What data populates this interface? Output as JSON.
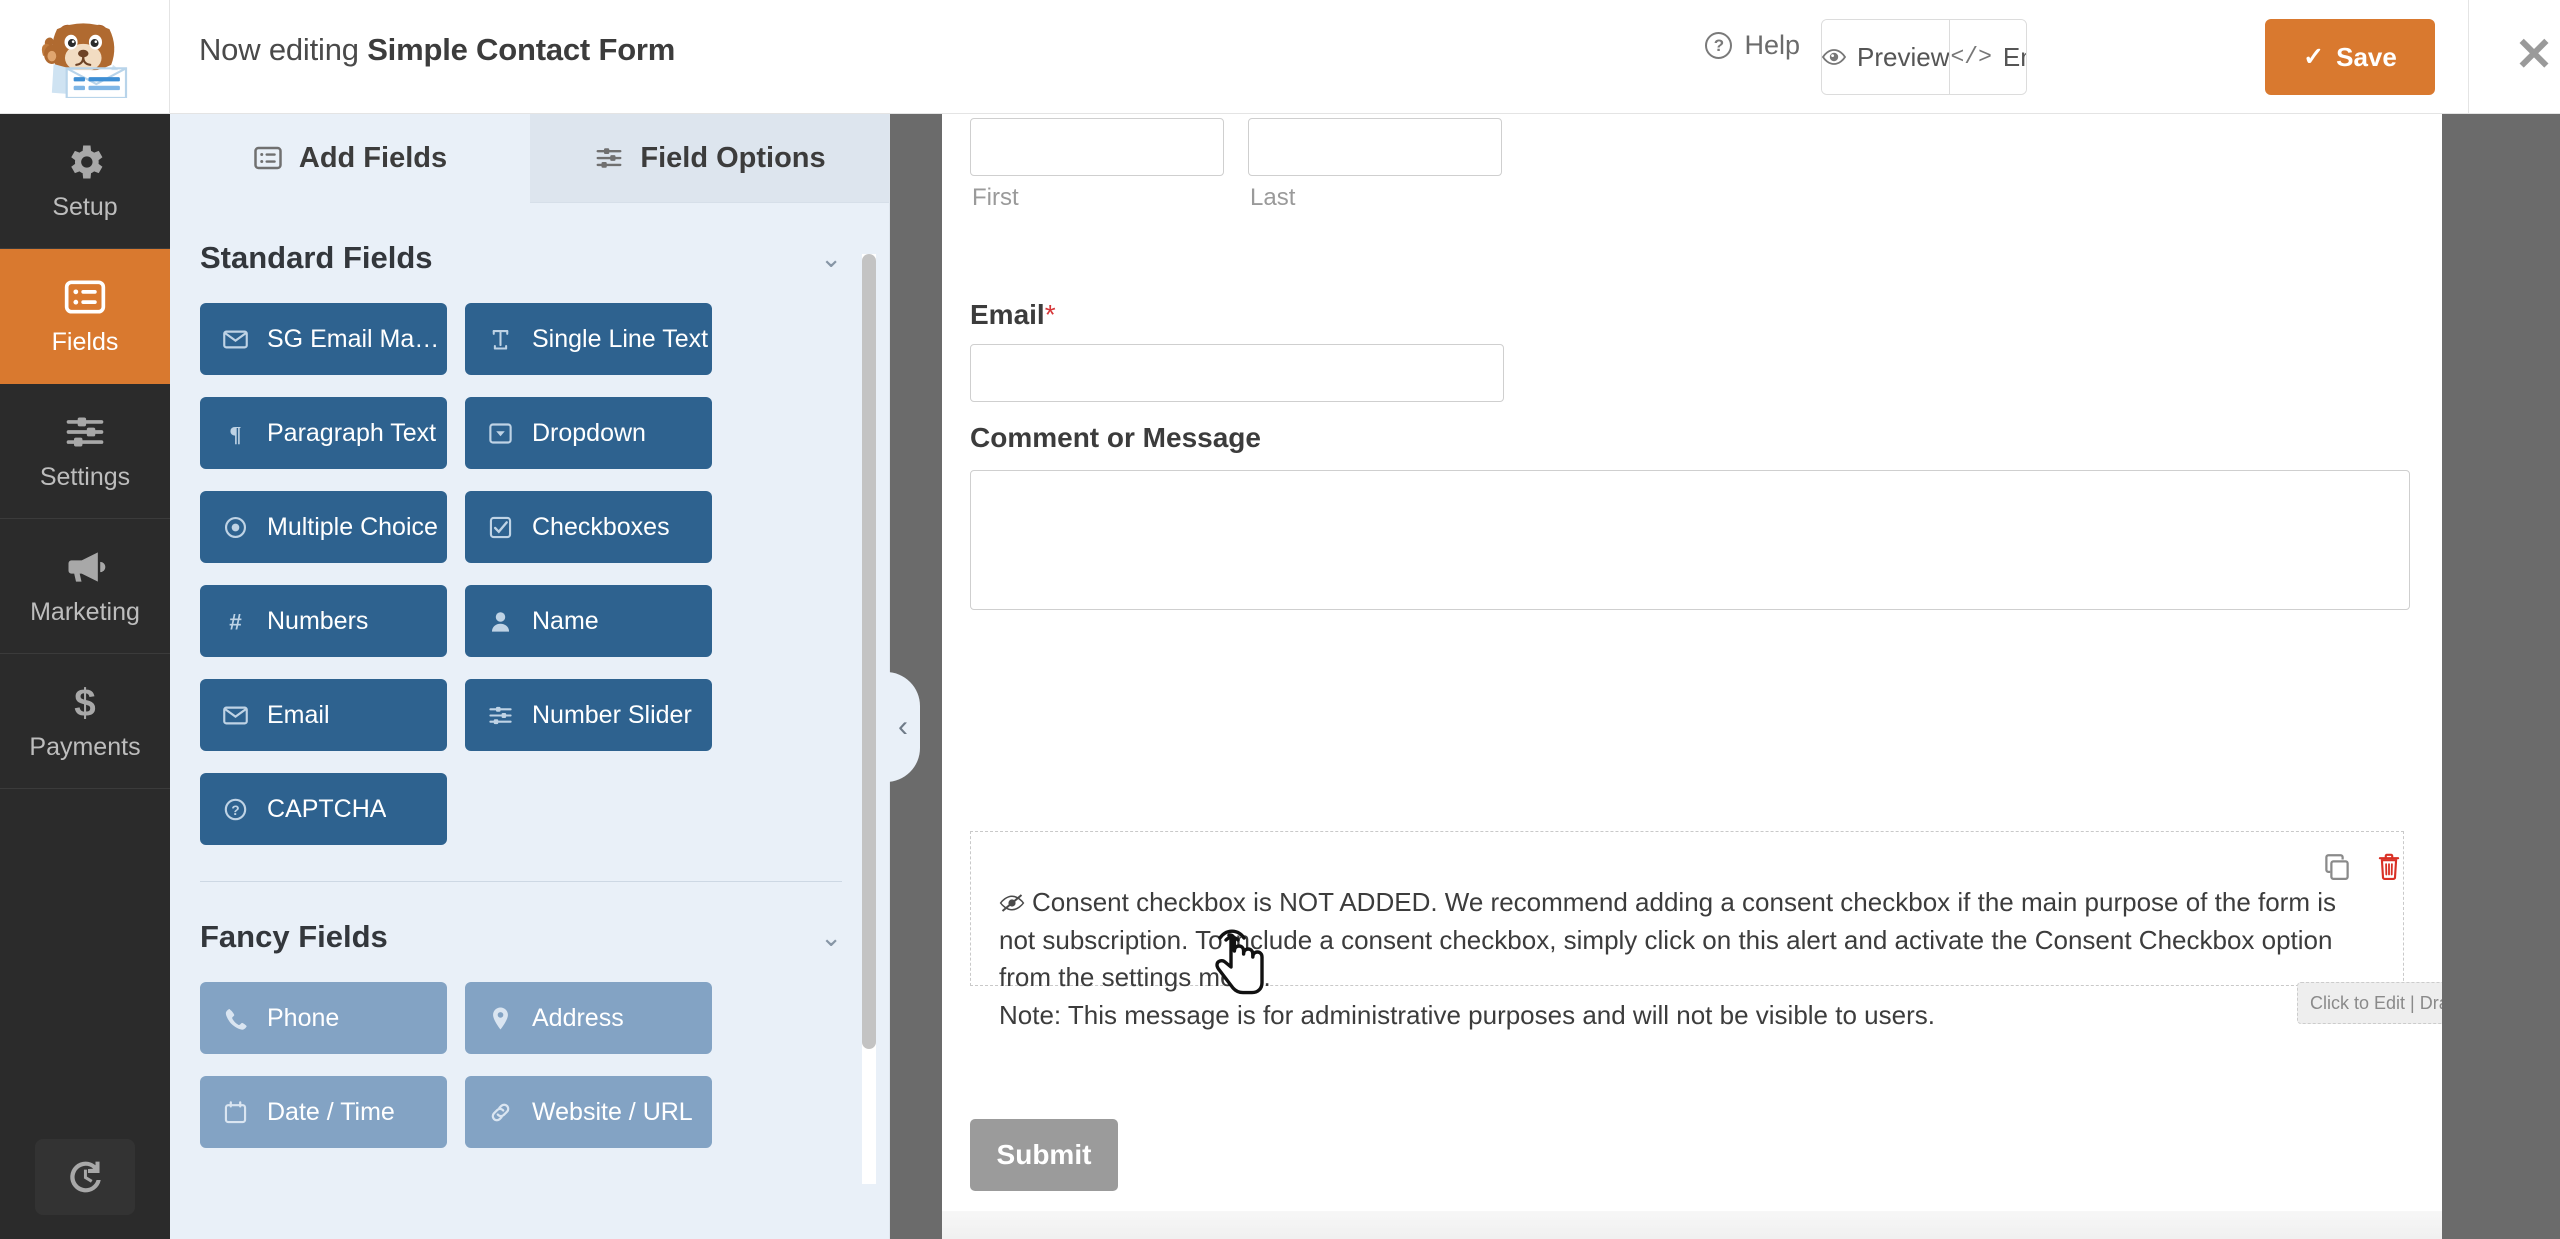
{
  "topbar": {
    "logo_icon": "wpforms-mascot-logo",
    "title_prefix": "Now editing ",
    "form_name": "Simple Contact Form",
    "help_label": "Help",
    "help_icon": "question-circle-icon",
    "preview_label": "Preview",
    "preview_icon": "eye-icon",
    "embed_label": "Embed",
    "embed_icon": "code-brackets-icon",
    "save_label": "Save",
    "save_icon": "check-icon",
    "close_icon": "close-x-icon",
    "save_color": "#d9792f"
  },
  "leftnav": {
    "items": [
      {
        "label": "Setup",
        "icon": "gear-icon",
        "active": false
      },
      {
        "label": "Fields",
        "icon": "list-card-icon",
        "active": true
      },
      {
        "label": "Settings",
        "icon": "sliders-icon",
        "active": false
      },
      {
        "label": "Marketing",
        "icon": "megaphone-icon",
        "active": false
      },
      {
        "label": "Payments",
        "icon": "dollar-icon",
        "active": false
      }
    ],
    "revisions_icon": "revision-history-icon",
    "active_color": "#d9792f",
    "bg_color": "#2b2b2b"
  },
  "panel": {
    "tabs": [
      {
        "label": "Add Fields",
        "icon": "list-card-icon",
        "active": true
      },
      {
        "label": "Field Options",
        "icon": "sliders-icon",
        "active": false
      }
    ],
    "sections": [
      {
        "title": "Standard Fields",
        "chevron": "chevron-down-icon",
        "style": "std",
        "fields": [
          {
            "label": "SG Email Marketi...",
            "icon": "envelope-icon"
          },
          {
            "label": "Single Line Text",
            "icon": "text-t-icon"
          },
          {
            "label": "Paragraph Text",
            "icon": "pilcrow-icon"
          },
          {
            "label": "Dropdown",
            "icon": "dropdown-caret-icon"
          },
          {
            "label": "Multiple Choice",
            "icon": "radio-dot-icon"
          },
          {
            "label": "Checkboxes",
            "icon": "checkbox-check-icon"
          },
          {
            "label": "Numbers",
            "icon": "hash-icon"
          },
          {
            "label": "Name",
            "icon": "user-icon"
          },
          {
            "label": "Email",
            "icon": "envelope-icon"
          },
          {
            "label": "Number Slider",
            "icon": "sliders-icon"
          },
          {
            "label": "CAPTCHA",
            "icon": "question-circle-icon"
          }
        ]
      },
      {
        "title": "Fancy Fields",
        "chevron": "chevron-down-icon",
        "style": "fancy",
        "fields": [
          {
            "label": "Phone",
            "icon": "phone-icon"
          },
          {
            "label": "Address",
            "icon": "map-pin-icon"
          },
          {
            "label": "Date / Time",
            "icon": "calendar-icon"
          },
          {
            "label": "Website / URL",
            "icon": "link-chain-icon"
          }
        ]
      }
    ],
    "collapse_icon": "chevron-left-icon",
    "std_color": "#2e628f",
    "fancy_color": "#83a3c4",
    "bg_color": "#e9f0f8"
  },
  "preview": {
    "name_field": {
      "first_sublabel": "First",
      "last_sublabel": "Last",
      "first_value": "",
      "last_value": ""
    },
    "email_field": {
      "label": "Email",
      "required_mark": "*",
      "value": ""
    },
    "message_field": {
      "label": "Comment or Message",
      "value": ""
    },
    "alert": {
      "icon": "eye-slash-icon",
      "line1": "Consent checkbox is NOT ADDED. We recommend adding a consent checkbox if the main purpose of the form is not subscription. To include a consent checkbox, simply click on this alert and activate the Consent Checkbox option from the settings menu.",
      "line2": "Note: This message is for administrative purposes and will not be visible to users.",
      "duplicate_icon": "duplicate-icon",
      "delete_icon": "trash-icon",
      "delete_color": "#d93025"
    },
    "drag_hint": {
      "text": "Click to Edit | Drag to Reorder",
      "dismiss_icon": "close-circle-icon"
    },
    "submit_label": "Submit",
    "submit_color": "#9b9b9b",
    "cursor_icon": "pointing-hand-cursor"
  }
}
